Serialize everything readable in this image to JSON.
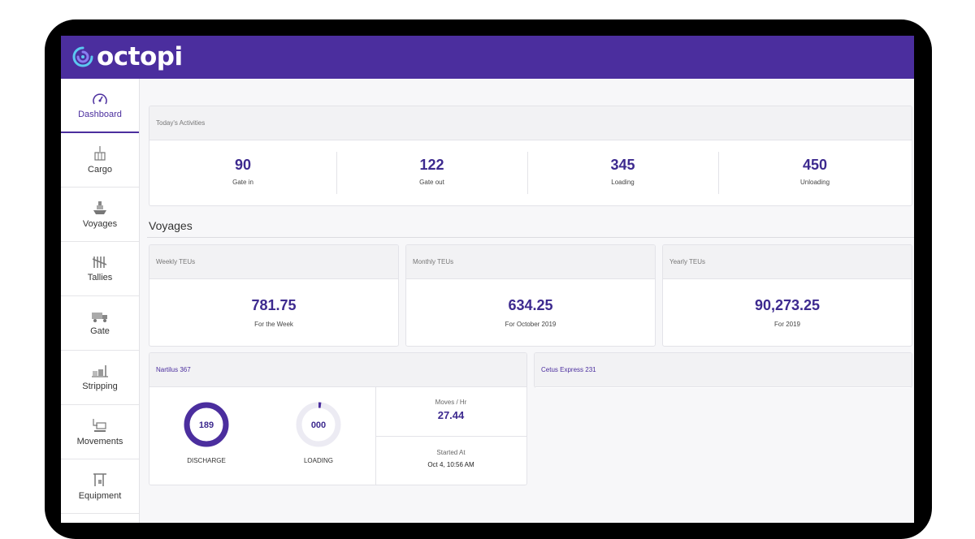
{
  "app": {
    "logo_text": "octopi",
    "brand_color": "#4b2e9e",
    "accent_color": "#3d2a8f"
  },
  "sidebar": {
    "items": [
      {
        "label": "Dashboard",
        "icon": "dashboard-gauge-icon",
        "active": true
      },
      {
        "label": "Cargo",
        "icon": "crane-cargo-icon"
      },
      {
        "label": "Voyages",
        "icon": "ship-icon"
      },
      {
        "label": "Tallies",
        "icon": "tally-marks-icon"
      },
      {
        "label": "Gate",
        "icon": "truck-icon"
      },
      {
        "label": "Stripping",
        "icon": "forklift-boxes-icon"
      },
      {
        "label": "Movements",
        "icon": "container-lift-icon"
      },
      {
        "label": "Equipment",
        "icon": "gantry-crane-icon"
      }
    ]
  },
  "activities": {
    "title": "Today's Activities",
    "stats": [
      {
        "value": "90",
        "label": "Gate in"
      },
      {
        "value": "122",
        "label": "Gate out"
      },
      {
        "value": "345",
        "label": "Loading"
      },
      {
        "value": "450",
        "label": "Unloading"
      }
    ]
  },
  "voyages": {
    "section_title": "Voyages",
    "weekly": {
      "title": "Weekly TEUs",
      "value": "781.75",
      "caption": "For the Week"
    },
    "monthly": {
      "title": "Monthly TEUs",
      "value": "634.25",
      "caption": "For October 2019"
    },
    "yearly": {
      "title": "Yearly TEUs",
      "value": "90,273.25",
      "caption": "For 2019"
    }
  },
  "vessel1": {
    "title": "Nartilus 367",
    "discharge": {
      "value": "189",
      "label": "DISCHARGE",
      "progress": 1.0
    },
    "loading": {
      "value": "000",
      "label": "LOADING",
      "progress": 0.02
    },
    "moves": {
      "label": "Moves / Hr",
      "value": "27.44"
    },
    "started": {
      "label": "Started At",
      "value": "Oct 4, 10:56 AM"
    }
  },
  "vessel2": {
    "title": "Cetus Express 231"
  }
}
